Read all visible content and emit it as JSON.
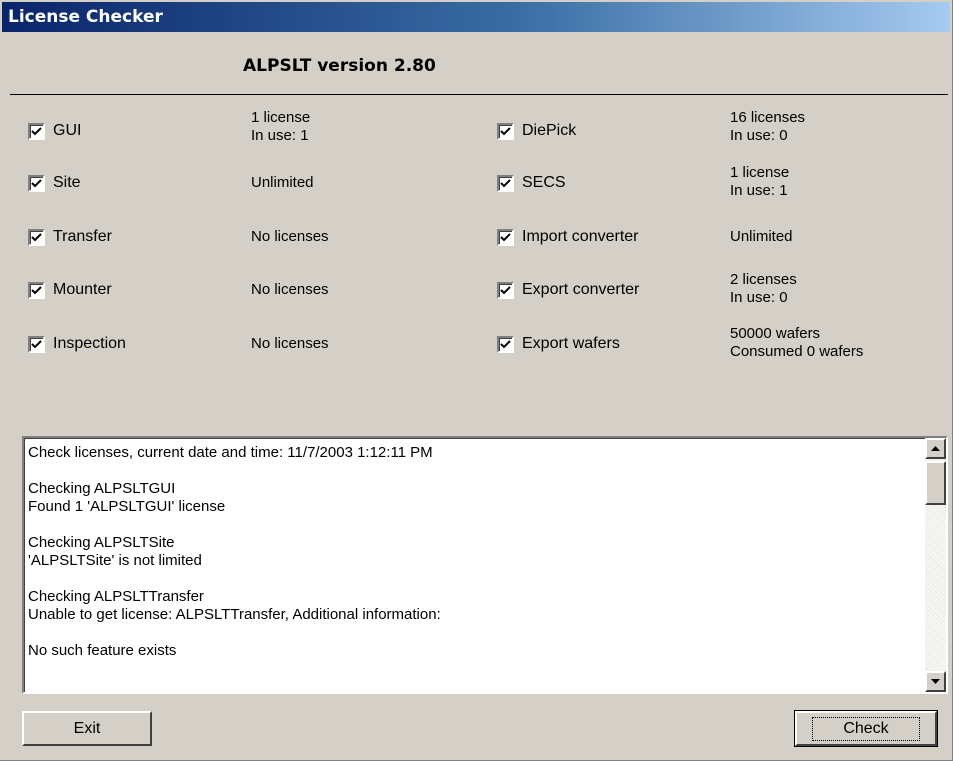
{
  "window": {
    "title": "License Checker"
  },
  "header": {
    "version": "ALPSLT version 2.80"
  },
  "features": [
    {
      "label": "GUI",
      "checked": true,
      "info": [
        "1 license",
        "In use: 1"
      ]
    },
    {
      "label": "Site",
      "checked": true,
      "info": [
        "Unlimited"
      ]
    },
    {
      "label": "Transfer",
      "checked": true,
      "info": [
        "No licenses"
      ]
    },
    {
      "label": "Mounter",
      "checked": true,
      "info": [
        "No licenses"
      ]
    },
    {
      "label": "Inspection",
      "checked": true,
      "info": [
        "No licenses"
      ]
    },
    {
      "label": "DiePick",
      "checked": true,
      "info": [
        "16 licenses",
        "In use: 0"
      ]
    },
    {
      "label": "SECS",
      "checked": true,
      "info": [
        "1 license",
        "In use: 1"
      ]
    },
    {
      "label": "Import converter",
      "checked": true,
      "info": [
        "Unlimited"
      ]
    },
    {
      "label": "Export converter",
      "checked": true,
      "info": [
        "2 licenses",
        "In use: 0"
      ]
    },
    {
      "label": "Export wafers",
      "checked": true,
      "info": [
        "50000 wafers",
        "Consumed 0 wafers"
      ]
    }
  ],
  "log": {
    "lines": [
      "Check licenses, current date and time: 11/7/2003 1:12:11 PM",
      "",
      "Checking ALPSLTGUI",
      "Found 1 'ALPSLTGUI' license",
      "",
      "Checking ALPSLTSite",
      "'ALPSLTSite' is not limited",
      "",
      "Checking ALPSLTTransfer",
      "Unable to get license: ALPSLTTransfer, Additional information:",
      "",
      "No such feature exists"
    ]
  },
  "buttons": {
    "exit": "Exit",
    "check": "Check"
  }
}
